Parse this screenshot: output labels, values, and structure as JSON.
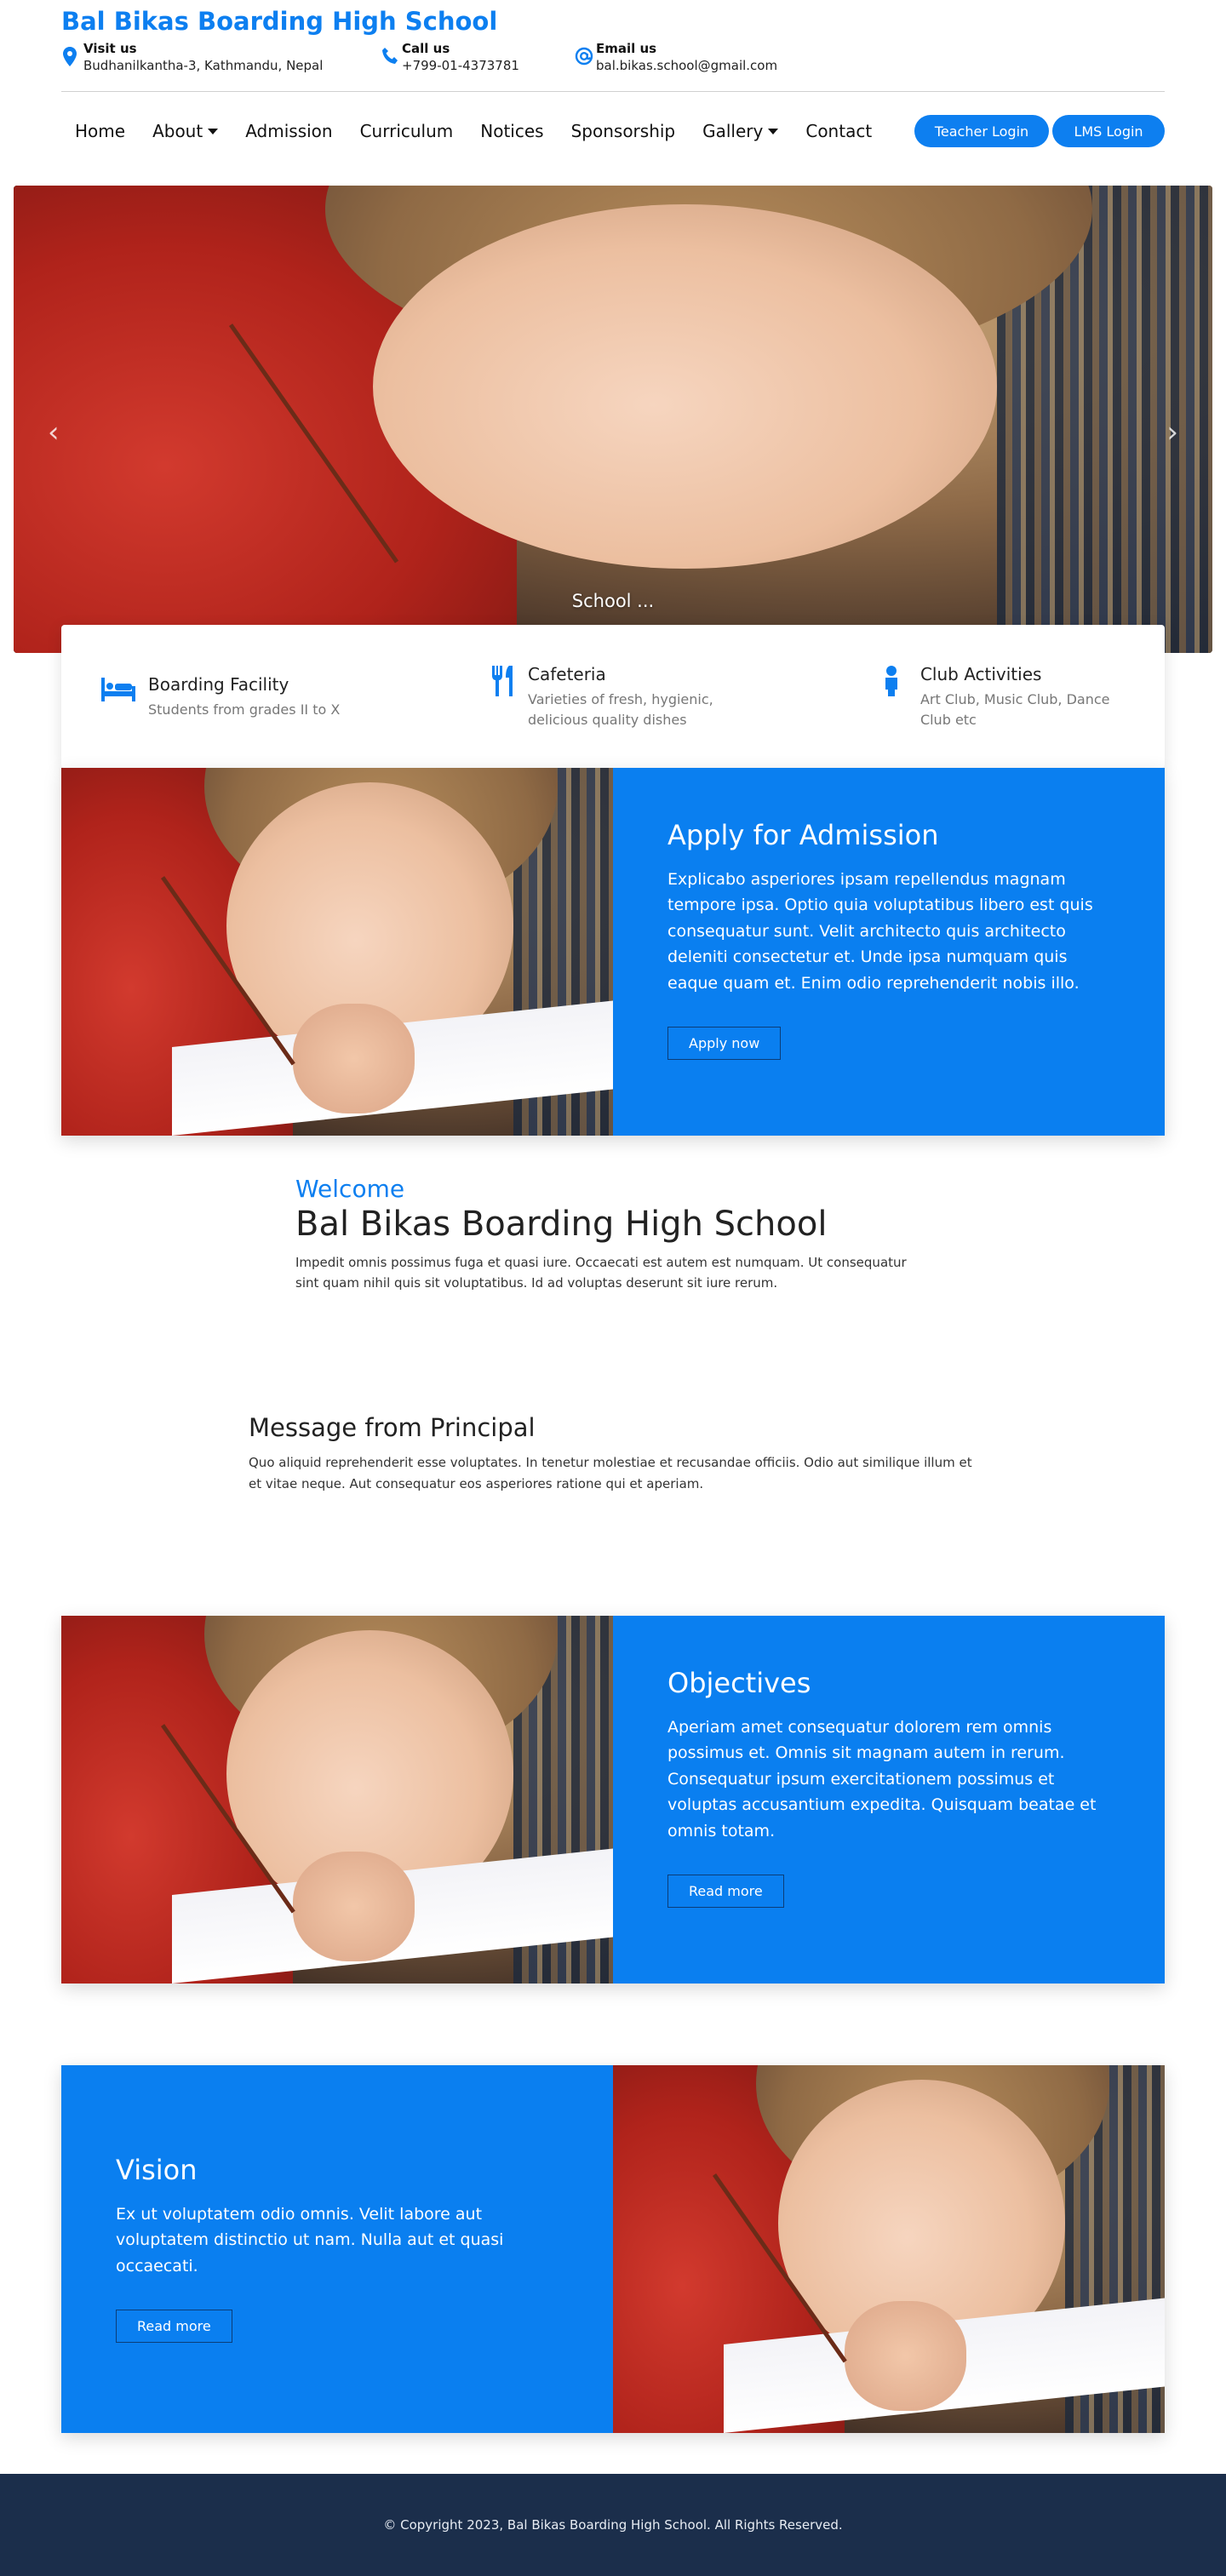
{
  "brand": {
    "name": "Bal Bikas Boarding High School",
    "color": "#0d7ff0"
  },
  "contacts": [
    {
      "icon": "map-pin-icon",
      "title": "Visit us",
      "value": "Budhanilkantha-3, Kathmandu, Nepal"
    },
    {
      "icon": "phone-icon",
      "title": "Call us",
      "value": "+799-01-4373781"
    },
    {
      "icon": "at-icon",
      "title": "Email us",
      "value": "bal.bikas.school@gmail.com"
    }
  ],
  "nav": {
    "items": [
      {
        "label": "Home",
        "dropdown": false
      },
      {
        "label": "About",
        "dropdown": true
      },
      {
        "label": "Admission",
        "dropdown": false
      },
      {
        "label": "Curriculum",
        "dropdown": false
      },
      {
        "label": "Notices",
        "dropdown": false
      },
      {
        "label": "Sponsorship",
        "dropdown": false
      },
      {
        "label": "Gallery",
        "dropdown": true
      },
      {
        "label": "Contact",
        "dropdown": false
      }
    ],
    "teacher_login": "Teacher Login",
    "lms_login": "LMS Login"
  },
  "hero": {
    "caption": "School ...",
    "prev_icon": "chevron-left-icon",
    "next_icon": "chevron-right-icon"
  },
  "features": [
    {
      "icon": "bed-icon",
      "title": "Boarding Facility",
      "desc": "Students from grades II to X"
    },
    {
      "icon": "utensils-icon",
      "title": "Cafeteria",
      "desc": "Varieties of fresh, hygienic, delicious quality dishes"
    },
    {
      "icon": "person-icon",
      "title": "Club Activities",
      "desc": "Art Club, Music Club, Dance Club etc"
    }
  ],
  "admission": {
    "title": "Apply for Admission",
    "body": "Explicabo asperiores ipsam repellendus magnam tempore ipsa. Optio quia voluptatibus libero est quis consequatur sunt. Velit architecto quis architecto deleniti consectetur et. Unde ipsa numquam quis eaque quam et. Enim odio reprehenderit nobis illo.",
    "button": "Apply now"
  },
  "welcome": {
    "subtitle": "Welcome",
    "title": "Bal Bikas Boarding High School",
    "body": "Impedit omnis possimus fuga et quasi iure. Occaecati est autem est numquam. Ut consequatur sint quam nihil quis sit voluptatibus. Id ad voluptas deserunt sit iure rerum."
  },
  "principal": {
    "title": "Message from Principal",
    "body": "Quo aliquid reprehenderit esse voluptates. In tenetur molestiae et recusandae officiis. Odio aut similique illum et et vitae neque. Aut consequatur eos asperiores ratione qui et aperiam."
  },
  "objectives": {
    "title": "Objectives",
    "body": "Aperiam amet consequatur dolorem rem omnis possimus et. Omnis sit magnam autem in rerum. Consequatur ipsum exercitationem possimus et voluptas accusantium expedita. Quisquam beatae et omnis totam.",
    "button": "Read more"
  },
  "vision": {
    "title": "Vision",
    "body": "Ex ut voluptatem odio omnis. Velit labore aut voluptatem distinctio ut nam. Nulla aut et quasi occaecati.",
    "button": "Read more"
  },
  "footer": {
    "text": "© Copyright 2023, Bal Bikas Boarding High School. All Rights Reserved."
  }
}
